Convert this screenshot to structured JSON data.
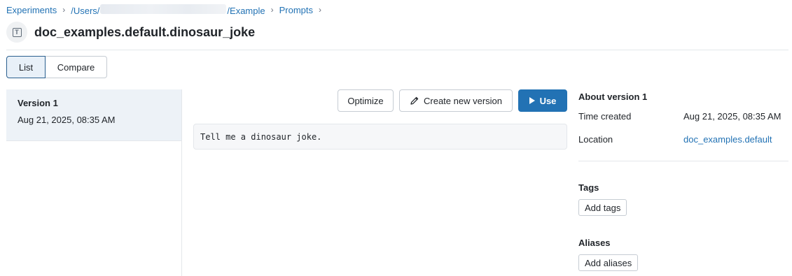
{
  "breadcrumb": {
    "experiments": "Experiments",
    "users_prefix": "/Users/",
    "example": "/Example",
    "prompts": "Prompts",
    "separator": "›"
  },
  "page": {
    "title": "doc_examples.default.dinosaur_joke",
    "title_icon_glyph": "T"
  },
  "view_toggle": {
    "list_label": "List",
    "compare_label": "Compare",
    "selected": "List"
  },
  "versions": [
    {
      "name": "Version 1",
      "date": "Aug 21, 2025, 08:35 AM"
    }
  ],
  "toolbar": {
    "optimize_label": "Optimize",
    "create_label": "Create new version",
    "use_label": "Use"
  },
  "prompt": {
    "text": "Tell me a dinosaur joke."
  },
  "details": {
    "about_title": "About version 1",
    "time_created_label": "Time created",
    "time_created_value": "Aug 21, 2025, 08:35 AM",
    "location_label": "Location",
    "location_value": "doc_examples.default",
    "tags_title": "Tags",
    "add_tags_label": "Add tags",
    "aliases_title": "Aliases",
    "add_aliases_label": "Add aliases"
  },
  "colors": {
    "accent": "#2272b4",
    "selected_bg": "#edf2f7",
    "border": "#c6ccd3"
  }
}
